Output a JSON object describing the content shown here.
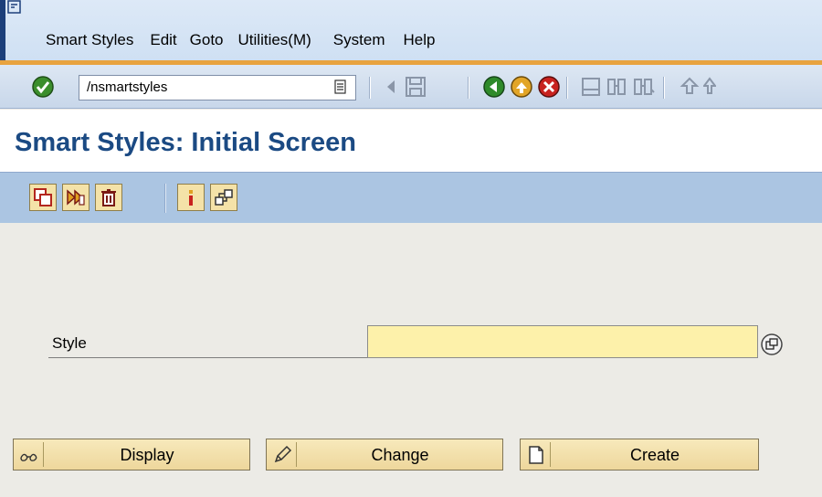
{
  "menu": {
    "items": [
      "Smart Styles",
      "Edit",
      "Goto",
      "Utilities(M)",
      "System",
      "Help"
    ]
  },
  "toolbar": {
    "command_value": "/nsmartstyles",
    "icons": [
      "enter-icon",
      "back-arrow-icon",
      "save-icon",
      "back-icon",
      "exit-icon",
      "cancel-icon",
      "print-icon",
      "find-icon",
      "find-next-icon",
      "first-page-icon",
      "previous-page-icon"
    ]
  },
  "page": {
    "title": "Smart Styles: Initial Screen"
  },
  "app_toolbar": {
    "icons": [
      "copy-icon",
      "rename-icon",
      "delete-icon",
      "info-icon",
      "hierarchy-icon"
    ]
  },
  "form": {
    "style_label": "Style",
    "style_value": ""
  },
  "actions": {
    "display": "Display",
    "change": "Change",
    "create": "Create"
  },
  "colors": {
    "title_blue": "#1b4a83",
    "input_yellow": "#fdf1aa",
    "button_bg": "#f4e2a8",
    "app_toolbar_bg": "#abc5e2",
    "toolbar_accent": "#e8a33f"
  }
}
